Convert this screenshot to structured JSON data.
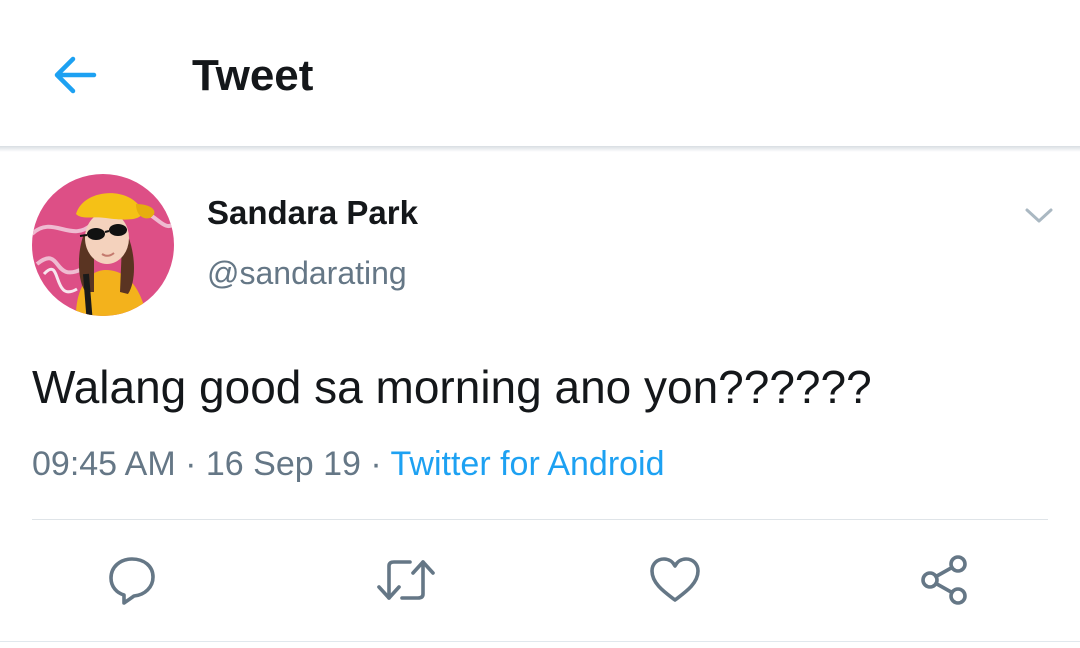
{
  "header": {
    "title": "Tweet",
    "back_icon": "arrow-left-icon"
  },
  "tweet": {
    "author": {
      "display_name": "Sandara Park",
      "handle": "@sandarating",
      "avatar": "profile-photo"
    },
    "text": "Walang good sa morning ano yon??????",
    "time": "09:45 AM",
    "separator": " · ",
    "date": "16 Sep 19",
    "source": "Twitter for Android"
  },
  "actions": [
    {
      "name": "reply",
      "icon": "reply-icon"
    },
    {
      "name": "retweet",
      "icon": "retweet-icon"
    },
    {
      "name": "like",
      "icon": "heart-icon"
    },
    {
      "name": "share",
      "icon": "share-icon"
    }
  ],
  "colors": {
    "accent": "#1da1f2",
    "text_primary": "#14171a",
    "text_secondary": "#657786",
    "icon": "#657786",
    "divider": "#e1e8ed"
  }
}
